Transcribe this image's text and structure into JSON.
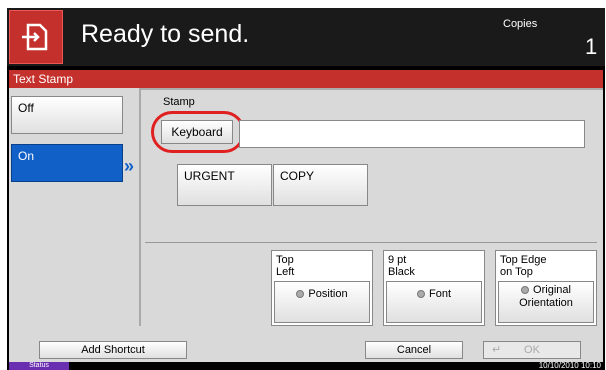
{
  "header": {
    "title": "Ready to send.",
    "copies_label": "Copies",
    "copies_value": "1"
  },
  "panel": {
    "title": "Text Stamp"
  },
  "options": {
    "off": "Off",
    "on": "On"
  },
  "stamp": {
    "label": "Stamp",
    "keyboard_button": "Keyboard",
    "input_value": ""
  },
  "phrases": [
    "URGENT",
    "COPY"
  ],
  "settings": [
    {
      "value_line1": "Top",
      "value_line2": "Left",
      "button": "Position"
    },
    {
      "value_line1": "9 pt",
      "value_line2": "Black",
      "button": "Font"
    },
    {
      "value_line1": "Top Edge",
      "value_line2": "on Top",
      "button_line1": "Original",
      "button_line2": "Orientation"
    }
  ],
  "footer": {
    "add_shortcut": "Add Shortcut",
    "cancel": "Cancel",
    "ok": "OK"
  },
  "statusbar": {
    "status": "Status",
    "datetime": "10/10/2010  10:10"
  },
  "colors": {
    "accent_red": "#c4302b",
    "selected_blue": "#1060c8",
    "status_purple": "#6a2fb0"
  }
}
